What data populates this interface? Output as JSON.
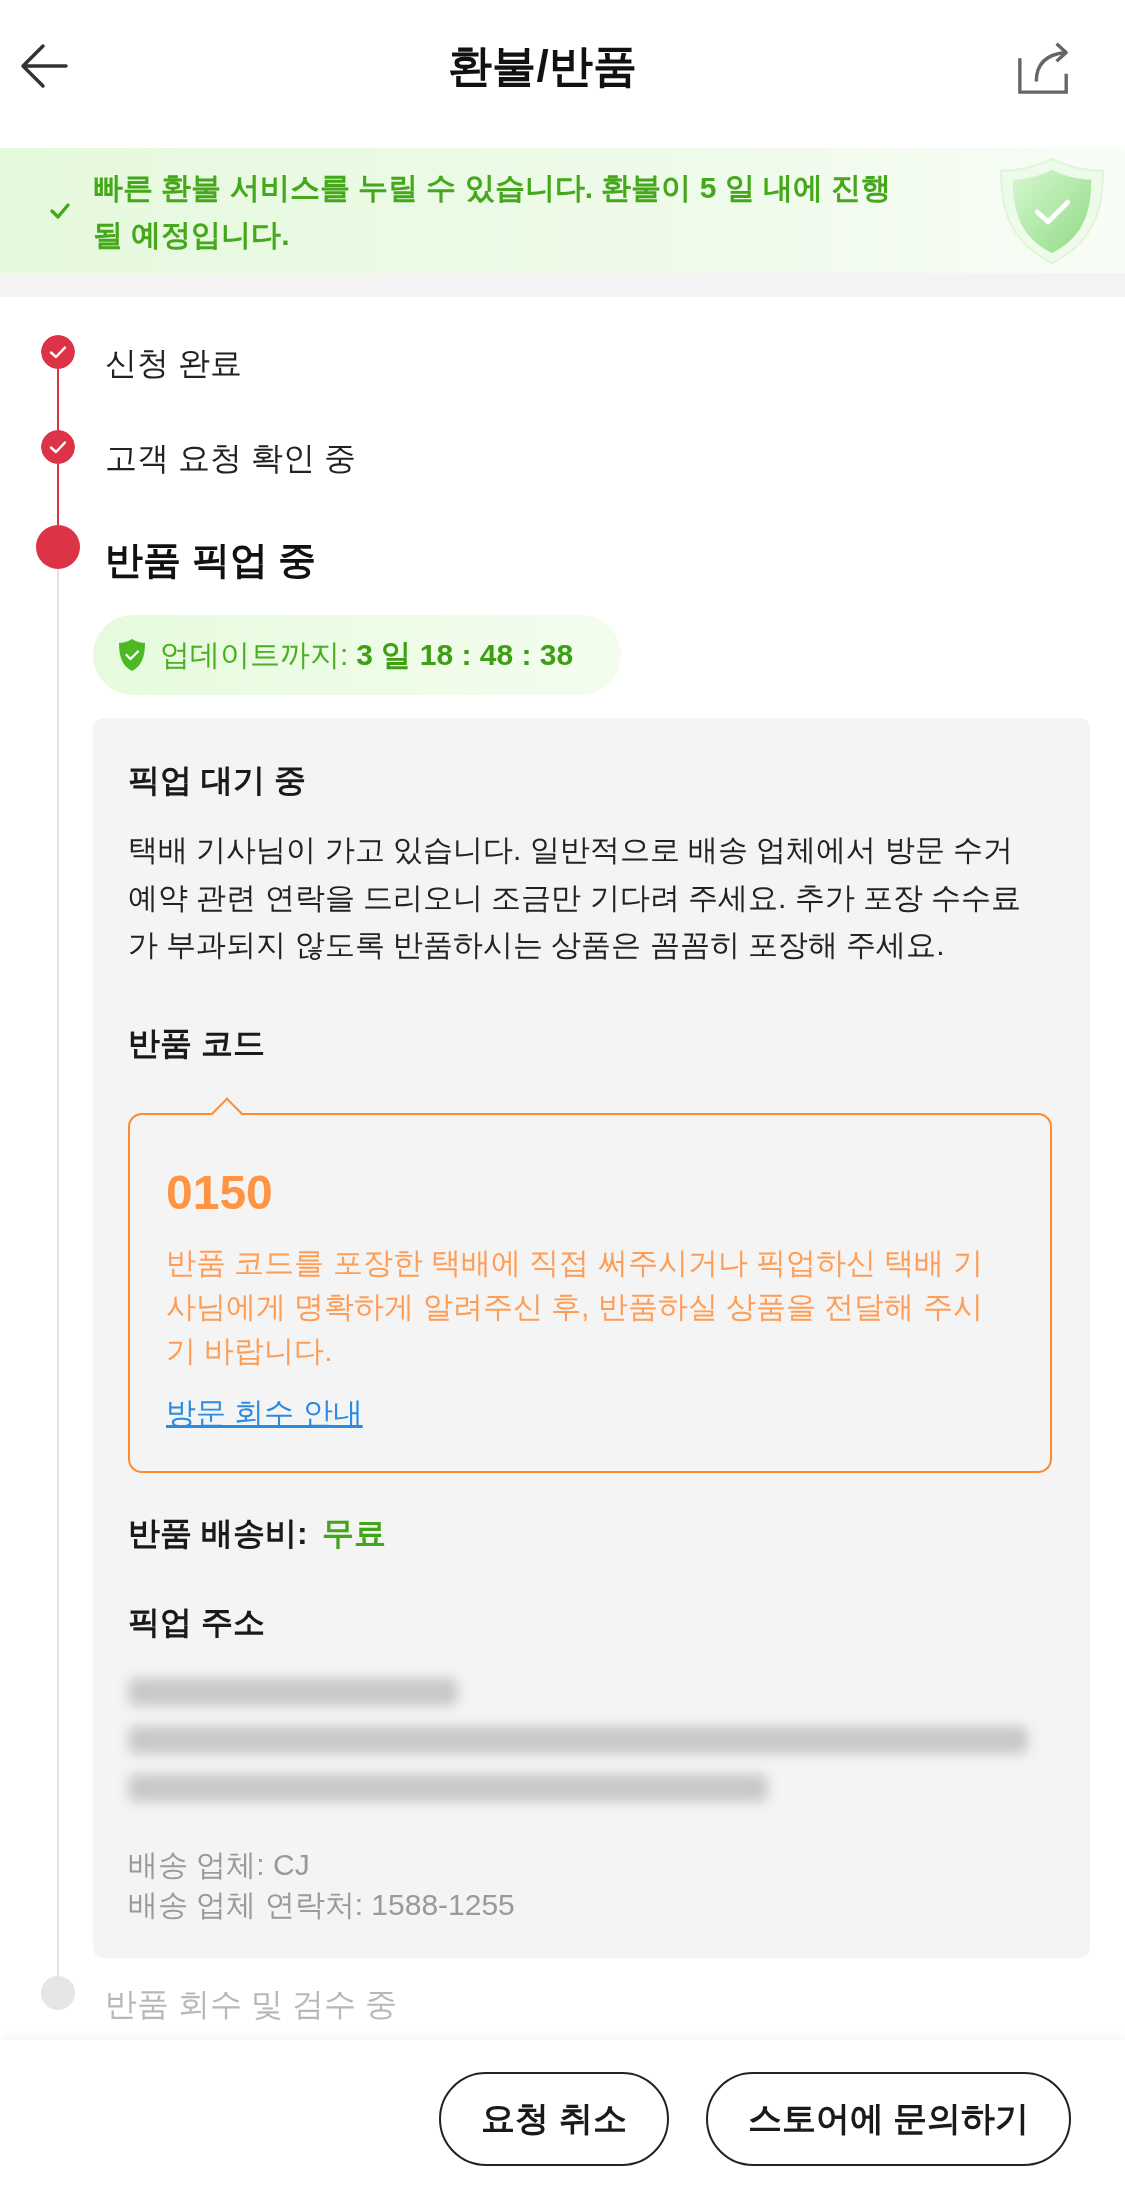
{
  "header": {
    "title": "환불/반품"
  },
  "notice": {
    "text": "빠른 환불 서비스를 누릴 수 있습니다. 환불이 5 일 내에 진행될 예정입니다."
  },
  "timeline": [
    {
      "label": "신청 완료",
      "completed": true,
      "current": false
    },
    {
      "label": "고객 요청 확인 중",
      "completed": true,
      "current": false
    },
    {
      "label": "반품 픽업 중",
      "completed": false,
      "current": true,
      "timer": {
        "label": "업데이트까지:",
        "value": "3 일 18 : 48 : 38"
      },
      "card": {
        "title": "픽업 대기 중",
        "description": "택배 기사님이 가고 있습니다. 일반적으로 배송 업체에서 방문 수거 예약 관련 연락을 드리오니 조금만 기다려 주세요. 추가 포장 수수료가 부과되지 않도록 반품하시는 상품은 꼼꼼히 포장해 주세요.",
        "return_code": {
          "heading": "반품 코드",
          "code": "0150",
          "instructions": "반품 코드를 포장한 택배에 직접 써주시거나 픽업하신 택배 기사님에게 명확하게 알려주신 후, 반품하실 상품을 전달해 주시기 바랍니다.",
          "link": "방문 회수 안내"
        },
        "shipping_fee": {
          "label": "반품 배송비:",
          "value": "무료"
        },
        "address": {
          "heading": "픽업 주소"
        },
        "carrier": "배송 업체: CJ",
        "carrier_contact": "배송 업체 연락처: 1588-1255"
      }
    },
    {
      "label": "반품 회수 및 검수 중",
      "completed": false,
      "current": false
    }
  ],
  "buttons": [
    {
      "label": "요청 취소"
    },
    {
      "label": "스토어에 문의하기"
    }
  ]
}
